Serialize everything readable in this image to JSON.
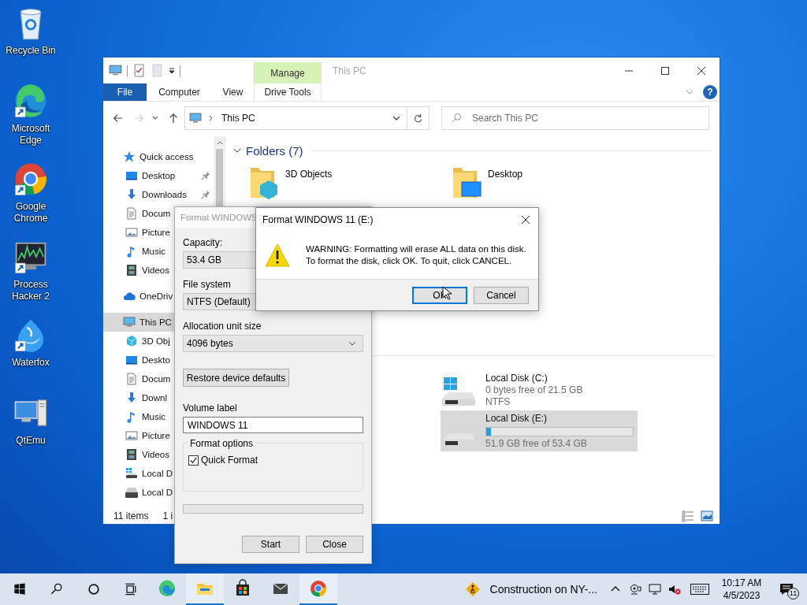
{
  "desktop_icons": [
    {
      "label": "Recycle Bin",
      "shortcut": false
    },
    {
      "label": "Microsoft Edge",
      "shortcut": true
    },
    {
      "label": "Google Chrome",
      "shortcut": true
    },
    {
      "label": "Process Hacker 2",
      "shortcut": true
    },
    {
      "label": "Waterfox",
      "shortcut": true
    },
    {
      "label": "QtEmu",
      "shortcut": false
    }
  ],
  "explorer": {
    "title": "This PC",
    "context_group": {
      "title": "Manage",
      "tabs": [
        "Drive Tools"
      ]
    },
    "file_tab": "File",
    "ribbon_tabs": [
      "Computer",
      "View"
    ],
    "help": "?",
    "address": {
      "path": [
        "This PC"
      ]
    },
    "search": {
      "placeholder": "Search This PC"
    },
    "nav": [
      {
        "label": "Quick access",
        "selected": false,
        "children": [
          {
            "label": "Desktop",
            "pinned": true,
            "selected": false
          },
          {
            "label": "Downloads",
            "pinned": true,
            "selected": false
          },
          {
            "label": "Docum",
            "selected": false
          },
          {
            "label": "Picture",
            "selected": false
          },
          {
            "label": "Music",
            "selected": false
          },
          {
            "label": "Videos",
            "selected": false
          }
        ]
      },
      {
        "label": "OneDriv",
        "selected": false
      },
      {
        "label": "This PC",
        "selected": true,
        "children": [
          {
            "label": "3D Obj",
            "selected": false
          },
          {
            "label": "Deskto",
            "selected": false
          },
          {
            "label": "Docum",
            "selected": false
          },
          {
            "label": "Downl",
            "selected": false
          },
          {
            "label": "Music",
            "selected": false
          },
          {
            "label": "Picture",
            "selected": false
          },
          {
            "label": "Videos",
            "selected": false
          },
          {
            "label": "Local D",
            "selected": false
          },
          {
            "label": "Local D",
            "selected": false
          }
        ]
      }
    ],
    "folders_header": "Folders (7)",
    "folders": [
      {
        "name": "3D Objects"
      },
      {
        "name": "Desktop"
      }
    ],
    "drives": [
      {
        "kind": "details",
        "name": "Local Disk (C:)",
        "system": true,
        "free": "0 bytes free of 21.5 GB",
        "filesystem": "NTFS",
        "selected": false
      },
      {
        "kind": "meter",
        "name": "Local Disk (E:)",
        "system": false,
        "level": 0.03,
        "free": "51.9 GB free of 53.4 GB",
        "selected": true
      }
    ],
    "status_bar": {
      "items": "11 items",
      "selection": "1 i"
    }
  },
  "format_dialog": {
    "title": "Format WINDOWS",
    "fields": [
      {
        "kind": "box",
        "label": "Capacity:",
        "value": "53.4 GB"
      },
      {
        "kind": "box",
        "label": "File system",
        "value": "NTFS (Default)"
      },
      {
        "kind": "select",
        "label": "Allocation unit size",
        "value": "4096 bytes"
      }
    ],
    "restore_button": "Restore device defaults",
    "volume_label": {
      "label": "Volume label",
      "value": "WINDOWS 11"
    },
    "format_options": {
      "title": "Format options",
      "quick_format": {
        "label": "Quick Format",
        "checked": true
      }
    },
    "progress": {
      "level": 0
    },
    "buttons": [
      "Start",
      "Close"
    ]
  },
  "warning_dialog": {
    "title": "Format WINDOWS 11 (E:)",
    "message": [
      "WARNING: Formatting will erase ALL data on this disk.",
      "To format the disk, click OK. To quit, click CANCEL."
    ],
    "buttons": [
      {
        "label": "OK",
        "default": true
      },
      {
        "label": "Cancel",
        "default": false
      }
    ]
  },
  "taskbar": {
    "apps": [
      {
        "running": false
      },
      {
        "running": true
      },
      {
        "running": false
      },
      {
        "running": false
      },
      {
        "running": true
      }
    ],
    "weather": "Construction on NY-...",
    "time": "10:17 AM",
    "date": "4/5/2023",
    "notifications": "11"
  }
}
